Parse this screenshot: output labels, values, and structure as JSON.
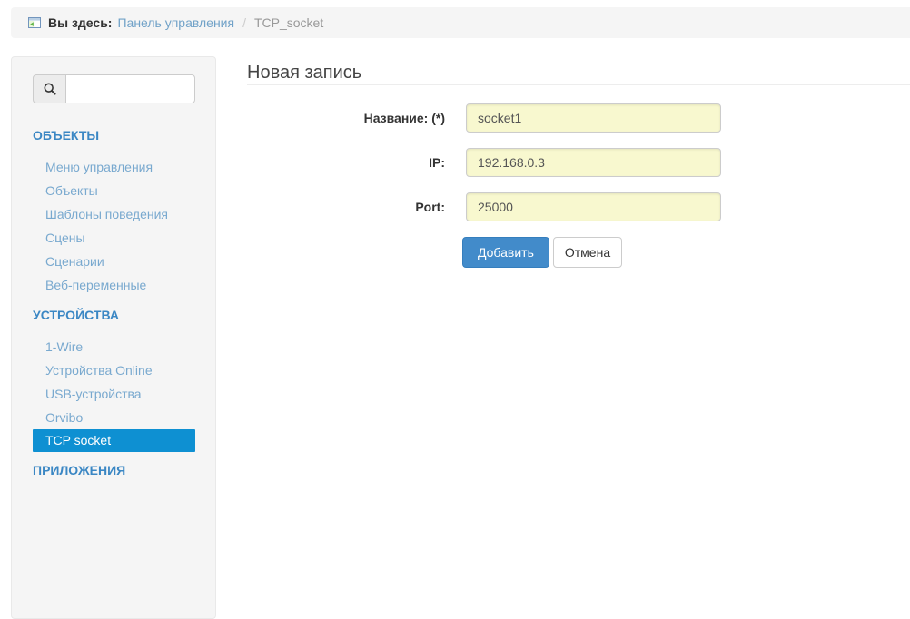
{
  "breadcrumb": {
    "prefix": "Вы здесь:",
    "home_link": "Панель управления",
    "separator": "/",
    "current": "TCP_socket"
  },
  "sidebar": {
    "search": {
      "value": "",
      "placeholder": ""
    },
    "sections": [
      {
        "label": "ОБЪЕКТЫ",
        "items": [
          {
            "label": "Меню управления"
          },
          {
            "label": "Объекты"
          },
          {
            "label": "Шаблоны поведения"
          },
          {
            "label": "Сцены"
          },
          {
            "label": "Сценарии"
          },
          {
            "label": "Веб-переменные"
          }
        ]
      },
      {
        "label": "УСТРОЙСТВА",
        "items": [
          {
            "label": "1-Wire"
          },
          {
            "label": "Устройства Online"
          },
          {
            "label": "USB-устройства"
          },
          {
            "label": "Orvibo"
          },
          {
            "label": "TCP socket",
            "active": true
          }
        ]
      },
      {
        "label": "ПРИЛОЖЕНИЯ",
        "items": []
      }
    ]
  },
  "main": {
    "title": "Новая запись",
    "form": {
      "fields": [
        {
          "label": "Название: (*)",
          "value": "socket1"
        },
        {
          "label": "IP:",
          "value": "192.168.0.3"
        },
        {
          "label": "Port:",
          "value": "25000"
        }
      ],
      "submit_label": "Добавить",
      "cancel_label": "Отмена"
    }
  },
  "colors": {
    "panel_bg": "#f5f5f5",
    "active_item_bg": "#0e90d2",
    "section_header_blue": "#3b87c4",
    "link_blue": "#72a3c8",
    "input_bg": "#f8f8cf",
    "primary_button_bg": "#428bca"
  },
  "icons": {
    "breadcrumb": "application-window-icon",
    "search": "search-icon"
  }
}
